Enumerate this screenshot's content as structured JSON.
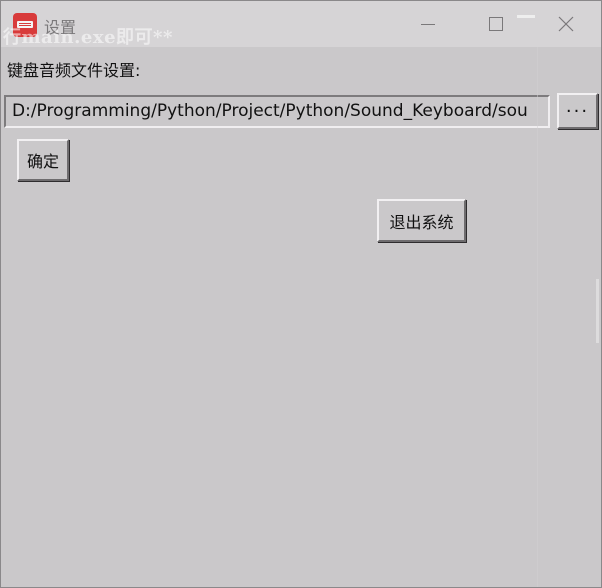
{
  "window": {
    "title": "设置",
    "icon": "keyboard-app-icon",
    "bleed_text": "行main.exe即可**"
  },
  "controls": {
    "minimize_icon": "minimize-icon",
    "maximize_icon": "maximize-icon",
    "close_icon": "close-icon"
  },
  "form": {
    "label": "键盘音频文件设置:",
    "path_value": "D:/Programming/Python/Project/Python/Sound_Keyboard/sou",
    "browse_label": "···",
    "ok_label": "确定",
    "exit_label": "退出系统"
  }
}
